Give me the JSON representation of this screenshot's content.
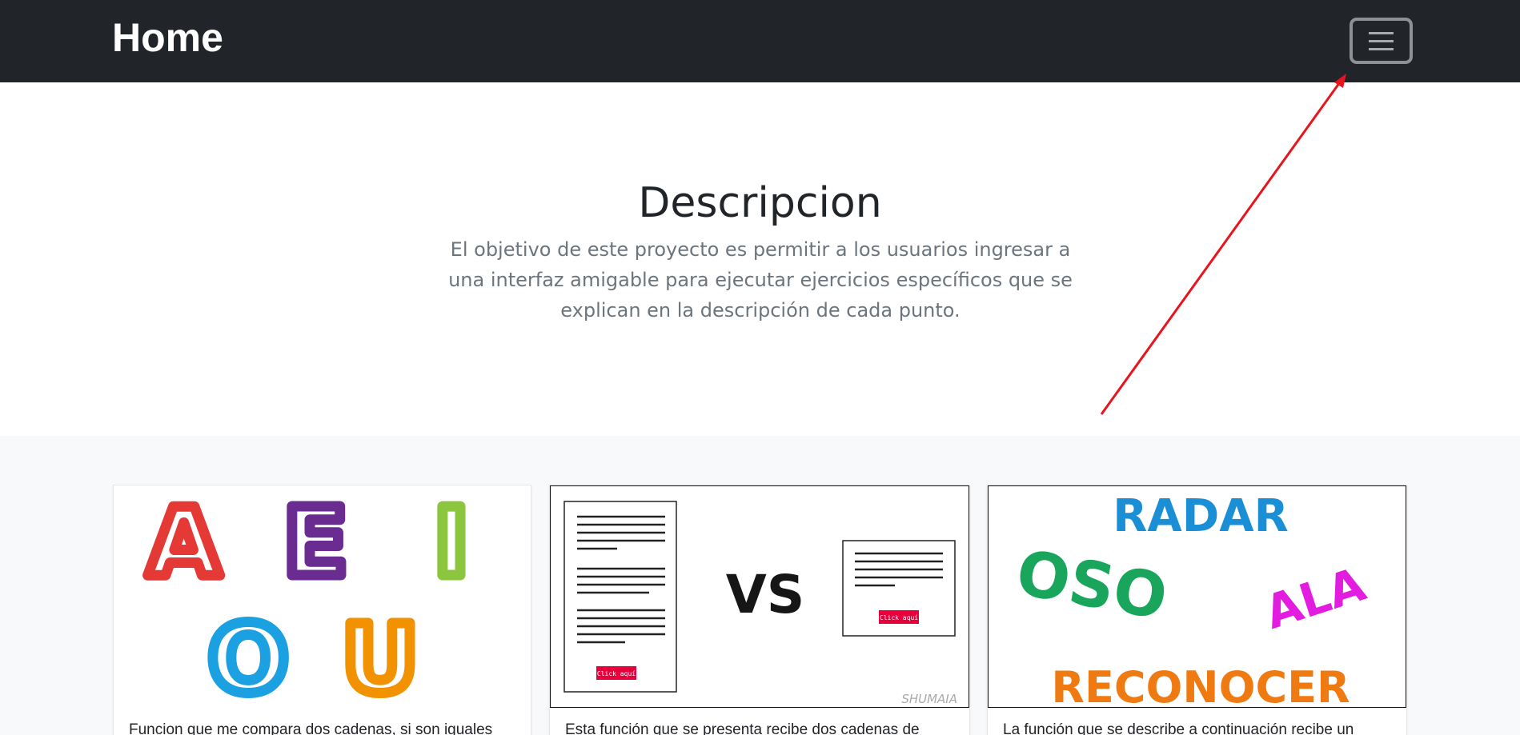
{
  "navbar": {
    "brand": "Home",
    "toggler_icon": "hamburger-menu-icon"
  },
  "hero": {
    "title": "Descripcion",
    "lead": "El objetivo de este proyecto es permitir a los usuarios ingresar a una interfaz amigable para ejecutar ejercicios específicos que se explican en la descripción de cada punto."
  },
  "cards": [
    {
      "image_letters": [
        "A",
        "E",
        "I",
        "O",
        "U"
      ],
      "text": "Funcion que me compara dos cadenas, si son iguales"
    },
    {
      "image_vs": "VS",
      "image_button": "¡Click aquí!",
      "image_watermark": "SHUMAIA",
      "text": "Esta función que se presenta recibe dos cadenas de"
    },
    {
      "image_words": [
        "RADAR",
        "OSO",
        "ALA",
        "RECONOCER"
      ],
      "text": "La función que se describe a continuación recibe un"
    }
  ],
  "annotation": {
    "arrow_color": "#e8141c"
  },
  "colors": {
    "navbar_bg": "#212529",
    "section_bg": "#f8f9fa",
    "vowel_a": "#e53935",
    "vowel_e": "#6a2c91",
    "vowel_i": "#8cc63f",
    "vowel_o": "#1ba1e2",
    "vowel_u": "#f39200"
  }
}
